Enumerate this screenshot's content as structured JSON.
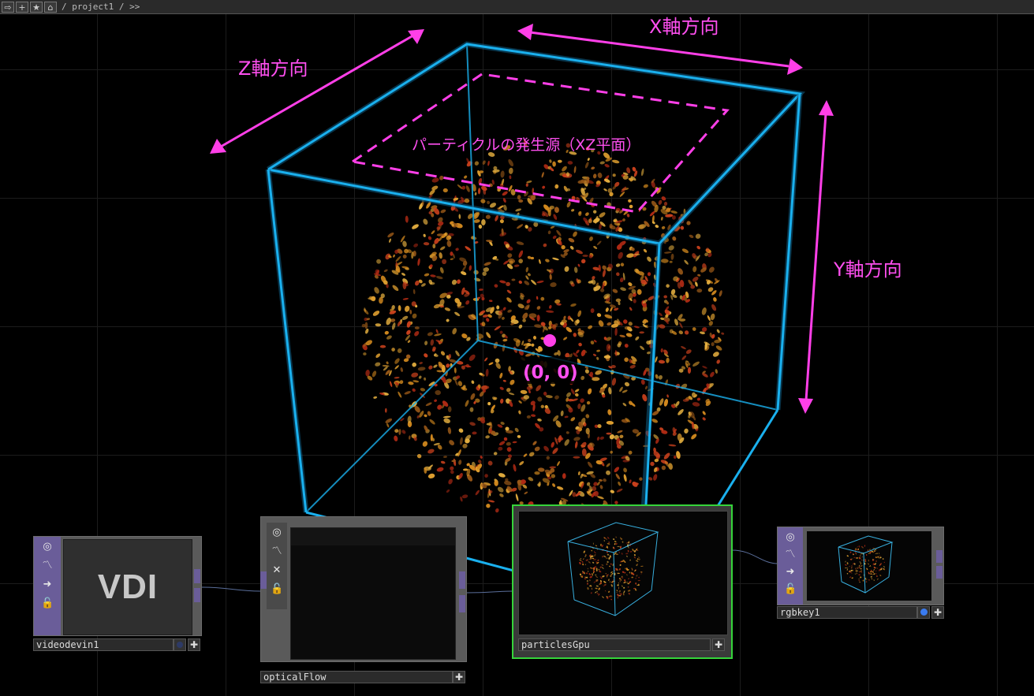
{
  "toolbar": {
    "buttons": [
      {
        "name": "back-arrow-icon",
        "glyph": "⇨"
      },
      {
        "name": "plus-icon",
        "glyph": "+"
      },
      {
        "name": "star-icon",
        "glyph": "★"
      },
      {
        "name": "home-icon",
        "glyph": "⌂"
      }
    ],
    "path": "/ project1 / >>"
  },
  "annotations": {
    "x_axis": "X軸方向",
    "y_axis": "Y軸方向",
    "z_axis": "Z軸方向",
    "xz_plane": "パーティクルの発生源（XZ平面）",
    "origin": "(0, 0)"
  },
  "colors": {
    "annotation": "#ff3fe8",
    "cube": "#1ab0ee",
    "selected_node_border": "#35d43a",
    "node_tab": "#6a5d99"
  },
  "nodes": {
    "videodevin1": {
      "name": "videodevin1",
      "preview_text": "VDI",
      "side_icons": [
        "view-icon",
        "graph-icon",
        "arrow-right-icon",
        "lock-icon"
      ]
    },
    "opticalFlow": {
      "name": "opticalFlow",
      "side_icons": [
        "view-icon",
        "graph-icon",
        "close-icon",
        "lock-icon"
      ]
    },
    "particlesGpu": {
      "name": "particlesGpu",
      "selected": true
    },
    "rgbkey1": {
      "name": "rgbkey1",
      "side_icons": [
        "view-icon",
        "graph-icon",
        "arrow-right-icon",
        "lock-icon"
      ]
    }
  }
}
